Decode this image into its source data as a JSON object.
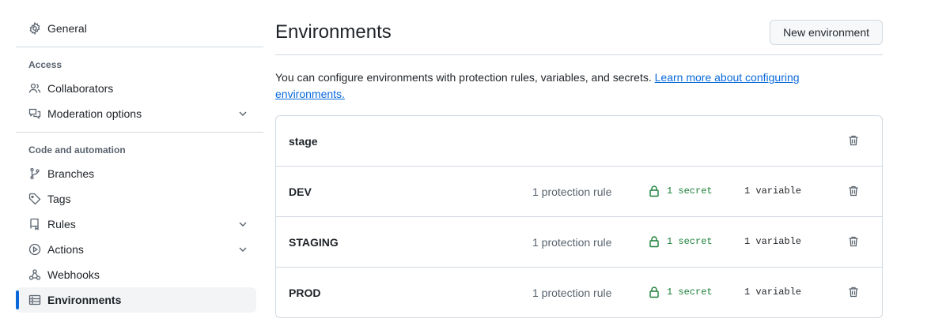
{
  "sidebar": {
    "general": "General",
    "access_title": "Access",
    "collaborators": "Collaborators",
    "moderation": "Moderation options",
    "code_title": "Code and automation",
    "branches": "Branches",
    "tags": "Tags",
    "rules": "Rules",
    "actions": "Actions",
    "webhooks": "Webhooks",
    "environments": "Environments"
  },
  "main": {
    "title": "Environments",
    "new_button": "New environment",
    "description": "You can configure environments with protection rules, variables, and secrets. ",
    "learn_more": "Learn more about configuring environments."
  },
  "environments": [
    {
      "name": "stage",
      "rule": "",
      "secret": "",
      "variable": ""
    },
    {
      "name": "DEV",
      "rule": "1 protection rule",
      "secret": "1 secret",
      "variable": "1 variable"
    },
    {
      "name": "STAGING",
      "rule": "1 protection rule",
      "secret": "1 secret",
      "variable": "1 variable"
    },
    {
      "name": "PROD",
      "rule": "1 protection rule",
      "secret": "1 secret",
      "variable": "1 variable"
    }
  ],
  "colors": {
    "accent": "#0969da",
    "success": "#1a7f37",
    "muted": "#59636e",
    "border": "#d1d9e0"
  },
  "icons": {
    "general": "gear-icon",
    "collaborators": "people-icon",
    "moderation": "comment-discussion-icon",
    "branches": "git-branch-icon",
    "tags": "tag-icon",
    "rules": "repo-push-icon",
    "actions": "play-icon",
    "webhooks": "webhook-icon",
    "environments": "server-icon",
    "secret": "lock-icon",
    "delete": "trash-icon"
  }
}
